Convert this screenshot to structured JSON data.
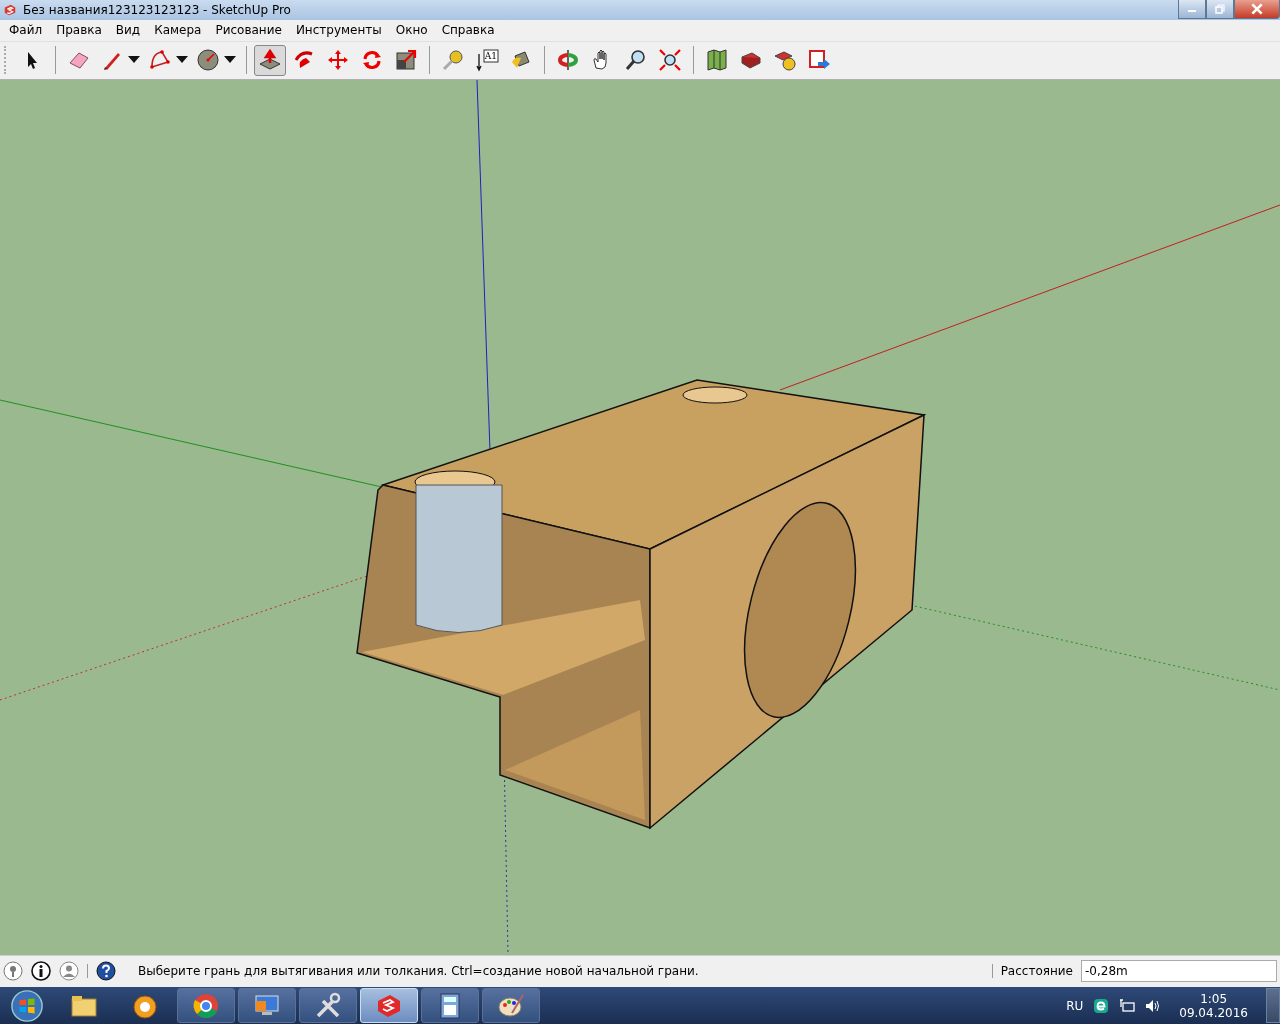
{
  "window": {
    "title": "Без названия123123123123 - SketchUp Pro"
  },
  "menu": [
    "Файл",
    "Правка",
    "Вид",
    "Камера",
    "Рисование",
    "Инструменты",
    "Окно",
    "Справка"
  ],
  "toolbar": {
    "groups": [
      [
        {
          "kind": "select",
          "selected": false,
          "dropdown": false
        }
      ],
      [
        {
          "kind": "eraser",
          "selected": false,
          "dropdown": false
        },
        {
          "kind": "pencil",
          "selected": false,
          "dropdown": true
        },
        {
          "kind": "arc",
          "selected": false,
          "dropdown": true
        },
        {
          "kind": "circle",
          "selected": false,
          "dropdown": true
        }
      ],
      [
        {
          "kind": "pushpull",
          "selected": true,
          "dropdown": false
        },
        {
          "kind": "followme",
          "selected": false,
          "dropdown": false
        },
        {
          "kind": "move",
          "selected": false,
          "dropdown": false
        },
        {
          "kind": "rotate",
          "selected": false,
          "dropdown": false
        },
        {
          "kind": "scale",
          "selected": false,
          "dropdown": false
        }
      ],
      [
        {
          "kind": "tape",
          "selected": false,
          "dropdown": false
        },
        {
          "kind": "text",
          "selected": false,
          "dropdown": false,
          "label": "A1"
        },
        {
          "kind": "paint",
          "selected": false,
          "dropdown": false
        }
      ],
      [
        {
          "kind": "orbit",
          "selected": false,
          "dropdown": false
        },
        {
          "kind": "pan",
          "selected": false,
          "dropdown": false
        },
        {
          "kind": "zoom",
          "selected": false,
          "dropdown": false
        },
        {
          "kind": "zoomext",
          "selected": false,
          "dropdown": false
        }
      ],
      [
        {
          "kind": "map",
          "selected": false,
          "dropdown": false
        },
        {
          "kind": "warehouse",
          "selected": false,
          "dropdown": false
        },
        {
          "kind": "share",
          "selected": false,
          "dropdown": false
        },
        {
          "kind": "upload",
          "selected": false,
          "dropdown": false
        }
      ]
    ]
  },
  "status_bar": {
    "message": "Выберите грань для вытягивания или толкания. Ctrl=создание новой начальной грани.",
    "measure_label": "Расстояние",
    "measure_value": "-0,28m"
  },
  "taskbar": {
    "apps": [
      {
        "kind": "folder",
        "active": false
      },
      {
        "kind": "player",
        "active": false
      },
      {
        "kind": "browser",
        "active": false
      },
      {
        "kind": "monitor",
        "active": false
      },
      {
        "kind": "tools",
        "active": false
      },
      {
        "kind": "sketchup",
        "active": true
      },
      {
        "kind": "calculator",
        "active": false
      },
      {
        "kind": "paint",
        "active": false
      }
    ],
    "language": "RU",
    "time": "1:05",
    "date": "09.04.2016"
  }
}
